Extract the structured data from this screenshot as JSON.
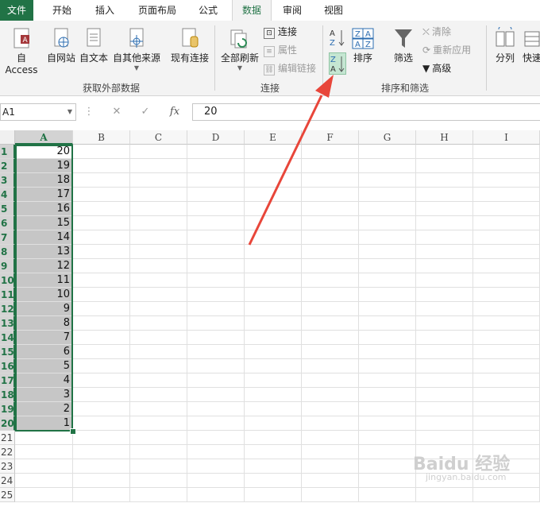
{
  "tabs": [
    "文件",
    "开始",
    "插入",
    "页面布局",
    "公式",
    "数据",
    "审阅",
    "视图"
  ],
  "ribbon": {
    "get_external": {
      "access": "自 Access",
      "web": "自网站",
      "text": "自文本",
      "other": "自其他来源",
      "existing": "现有连接",
      "label": "获取外部数据"
    },
    "connections": {
      "refresh_all": "全部刷新",
      "connections": "连接",
      "properties": "属性",
      "edit_links": "编辑链接",
      "label": "连接"
    },
    "sort_filter": {
      "sort_az": "A↓Z",
      "sort_za": "Z↓A",
      "sort": "排序",
      "filter": "筛选",
      "clear": "清除",
      "reapply": "重新应用",
      "advanced": "高级",
      "label": "排序和筛选"
    },
    "tools": {
      "split": "分列",
      "flash": "快速"
    }
  },
  "formula_bar": {
    "name_box": "A1",
    "fx": "fx",
    "cancel": "✕",
    "enter": "✓",
    "value": "20"
  },
  "columns": [
    "A",
    "B",
    "C",
    "D",
    "E",
    "F",
    "G",
    "H",
    "I"
  ],
  "rows": [
    "1",
    "2",
    "3",
    "4",
    "5",
    "6",
    "7",
    "8",
    "9",
    "10",
    "11",
    "12",
    "13",
    "14",
    "15",
    "16",
    "17",
    "18",
    "19",
    "20",
    "21",
    "22",
    "23",
    "24",
    "25"
  ],
  "column_a_values": [
    20,
    19,
    18,
    17,
    16,
    15,
    14,
    13,
    12,
    11,
    10,
    9,
    8,
    7,
    6,
    5,
    4,
    3,
    2,
    1
  ],
  "watermark": {
    "brand": "Baidu 经验",
    "url": "jingyan.baidu.com"
  },
  "colors": {
    "accent": "#217346",
    "arrow": "#e8463a"
  }
}
